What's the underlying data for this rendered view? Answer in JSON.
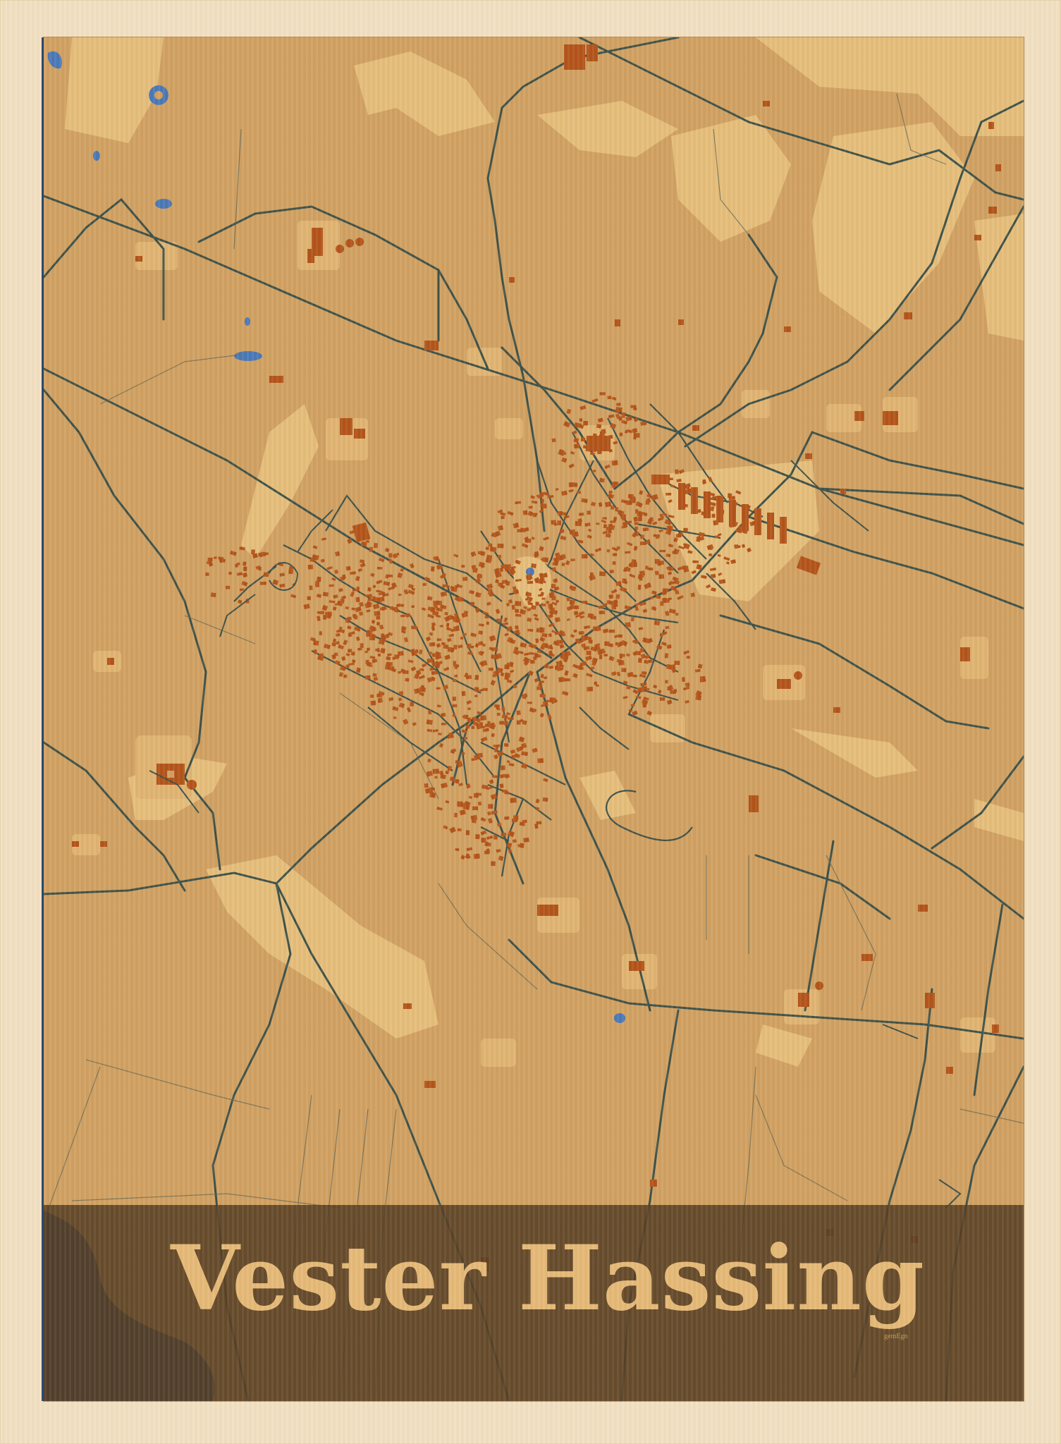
{
  "poster": {
    "title": "Vester Hassing",
    "brand": "gemEgn"
  },
  "colors": {
    "frame": "#f2dfc1",
    "land": "#d0a062",
    "light_land": "#e5bd7a",
    "roads": "#3f5249",
    "buildings": "#b3541a",
    "water": "#4b79b6",
    "sea": "#2b4360",
    "title_band": "#58402499",
    "title_text": "#e5b977"
  },
  "map": {
    "features": [
      "roads",
      "buildings",
      "fields",
      "ponds",
      "sea",
      "town-center"
    ]
  }
}
